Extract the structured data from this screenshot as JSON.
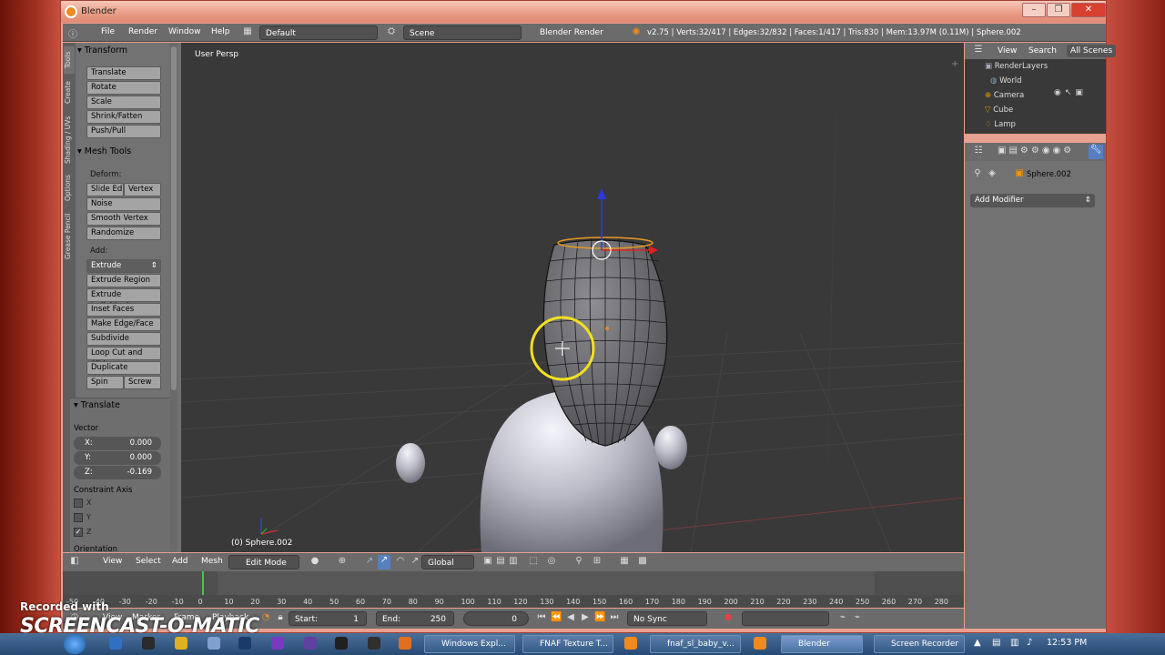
{
  "window": {
    "title": "Blender"
  },
  "main_header": {
    "menus": [
      "File",
      "Render",
      "Window",
      "Help"
    ],
    "layout": "Default",
    "scene": "Scene",
    "engine": "Blender Render",
    "stats": "v2.75 | Verts:32/417 | Edges:32/832 | Faces:1/417 | Tris:830 | Mem:13.97M (0.11M) | Sphere.002"
  },
  "toolshelf": {
    "tabs": [
      "Tools",
      "Create",
      "Shading / UVs",
      "Options",
      "Grease Pencil"
    ],
    "transform": {
      "title": "Transform",
      "buttons": [
        "Translate",
        "Rotate",
        "Scale",
        "Shrink/Fatten",
        "Push/Pull"
      ]
    },
    "mesh_tools": {
      "title": "Mesh Tools",
      "deform_label": "Deform:",
      "slide_edge": "Slide Ed",
      "vertex": "Vertex",
      "deform_buttons": [
        "Noise",
        "Smooth Vertex",
        "Randomize"
      ],
      "add_label": "Add:",
      "extrude": "Extrude",
      "add_buttons": [
        "Extrude Region",
        "Extrude Individual",
        "Inset Faces",
        "Make Edge/Face",
        "Subdivide",
        "Loop Cut and Slide",
        "Duplicate"
      ],
      "spin": "Spin",
      "screw": "Screw"
    },
    "operator": {
      "title": "Translate",
      "vector_label": "Vector",
      "x_label": "X:",
      "x": "0.000",
      "y_label": "Y:",
      "y": "0.000",
      "z_label": "Z:",
      "z": "-0.169",
      "constraint_label": "Constraint Axis",
      "axes": [
        "X",
        "Y",
        "Z"
      ],
      "orientation_label": "Orientation"
    }
  },
  "viewport": {
    "label": "User Persp",
    "object": "(0) Sphere.002"
  },
  "view3d_header": {
    "menus": [
      "View",
      "Select",
      "Add",
      "Mesh"
    ],
    "mode": "Edit Mode",
    "orientation": "Global"
  },
  "timeline": {
    "ticks": [
      "-50",
      "-40",
      "-30",
      "-20",
      "-10",
      "0",
      "10",
      "20",
      "30",
      "40",
      "50",
      "60",
      "70",
      "80",
      "90",
      "100",
      "110",
      "120",
      "130",
      "140",
      "150",
      "160",
      "170",
      "180",
      "190",
      "200",
      "210",
      "220",
      "230",
      "240",
      "250",
      "260",
      "270",
      "280"
    ],
    "menus": [
      "View",
      "Marker",
      "Frame",
      "Playback"
    ],
    "start_label": "Start:",
    "start": "1",
    "end_label": "End:",
    "end": "250",
    "current": "0",
    "sync": "No Sync",
    "current_frame": 0
  },
  "outliner": {
    "menus": [
      "View",
      "Search",
      "All Scenes"
    ],
    "items": [
      "RenderLayers",
      "World",
      "Camera",
      "Cube",
      "Lamp"
    ]
  },
  "properties": {
    "object": "Sphere.002",
    "add_modifier": "Add Modifier"
  },
  "taskbar": {
    "tasks": [
      "Windows Expl...",
      "FNAF Texture T...",
      "fnaf_sl_baby_v...",
      "Blender",
      "Screen Recorder"
    ],
    "clock": "12:53 PM"
  },
  "watermark": {
    "line1": "Recorded with",
    "line2": "SCREENCAST-O-MATIC"
  },
  "colors": {
    "viewport_bg": "#393939",
    "panel_bg": "#727272",
    "header_bg": "#6b6b6b",
    "highlight_blue": "#5680c2",
    "cursor_ring": "#f2e020"
  }
}
